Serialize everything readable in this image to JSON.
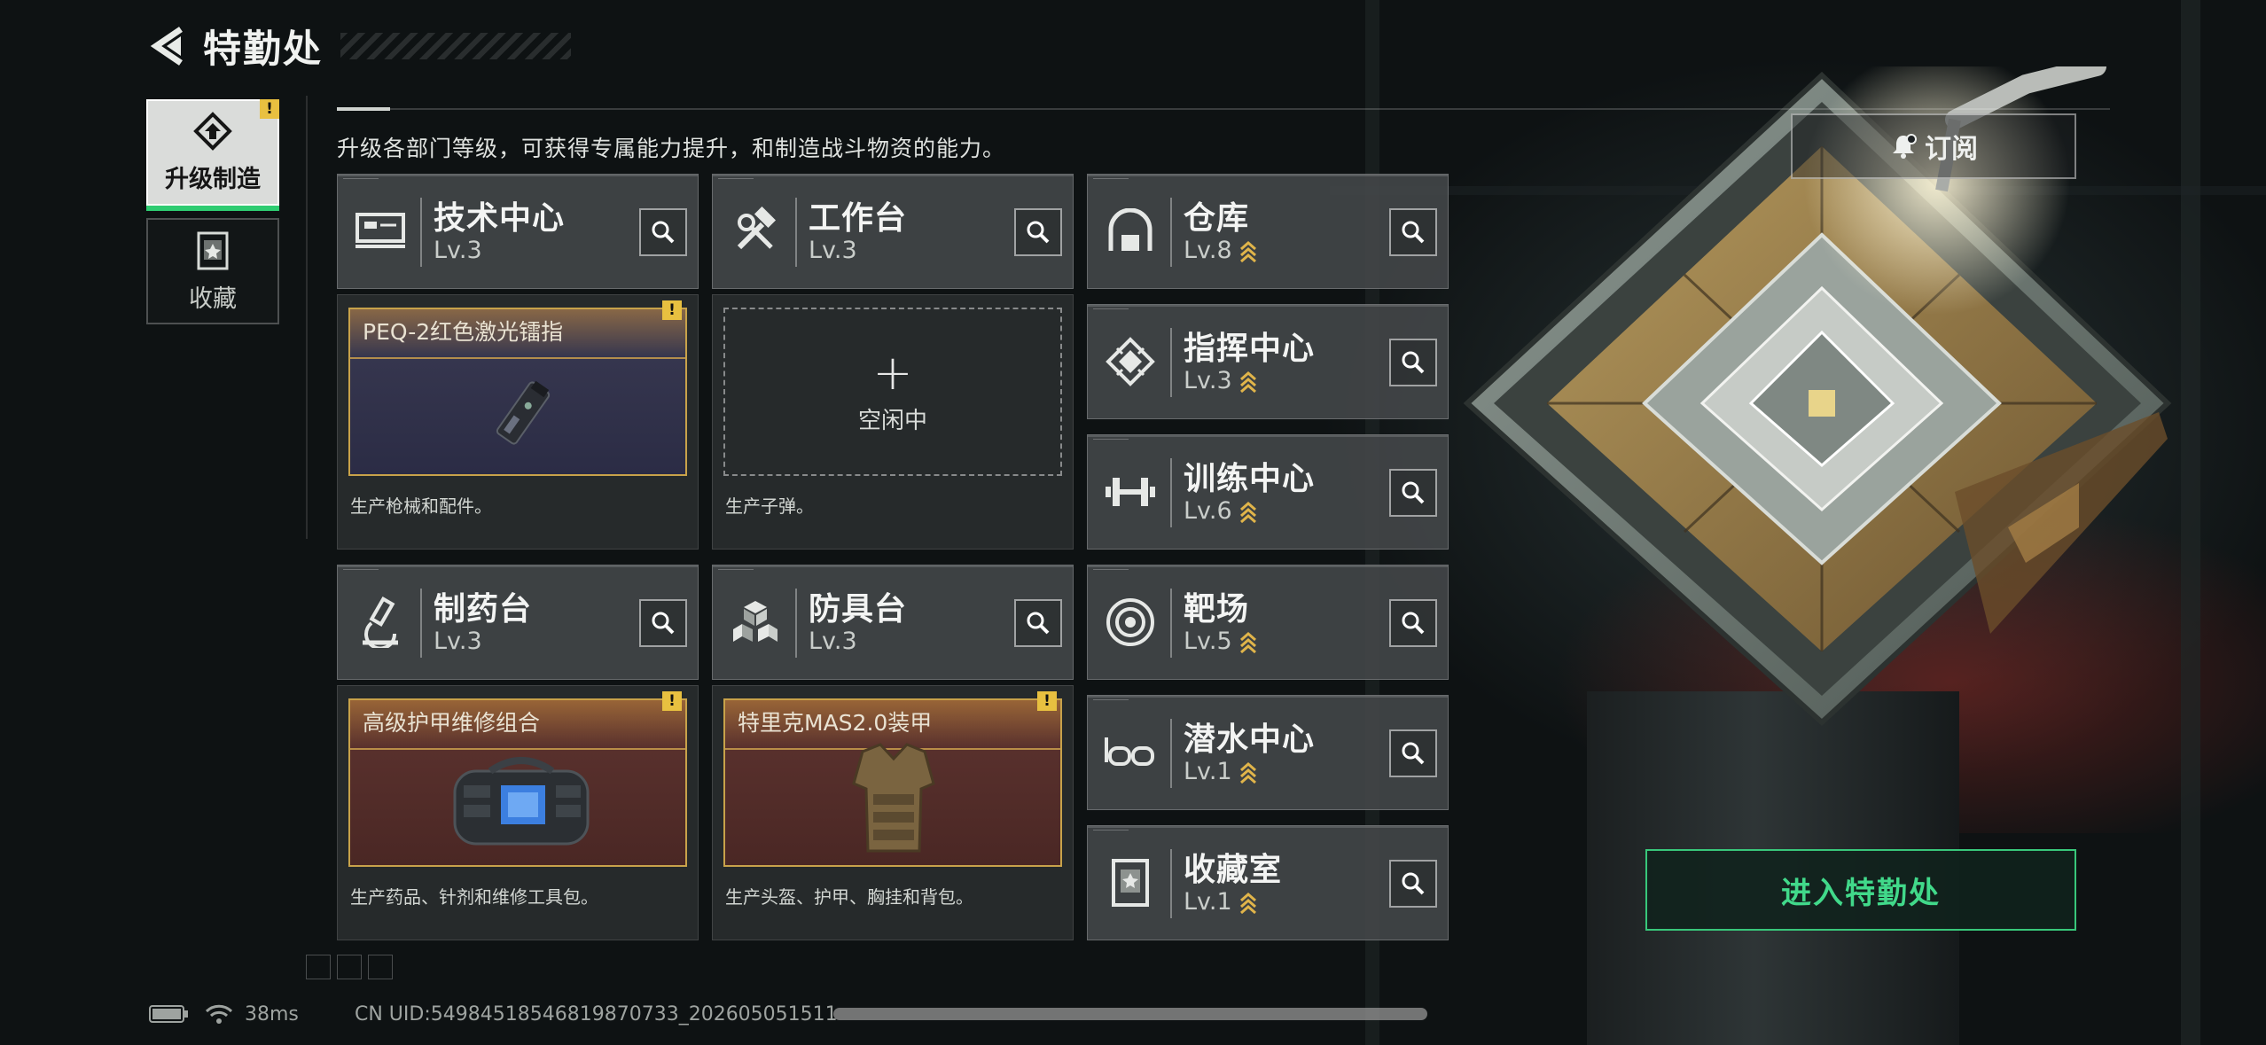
{
  "header": {
    "title": "特勤处"
  },
  "sidebar": {
    "tabs": [
      {
        "label": "升级制造",
        "active": true,
        "warning": "!"
      },
      {
        "label": "收藏",
        "active": false
      }
    ]
  },
  "intro": "升级各部门等级，可获得专属能力提升，和制造战斗物资的能力。",
  "subscribe_label": "订阅",
  "enter_label": "进入特勤处",
  "accent_color": "#41d98a",
  "warning_color": "#e8c040",
  "departments": {
    "tech": {
      "name": "技术中心",
      "level": "Lv.3",
      "icon": "tech-center-icon"
    },
    "workbench": {
      "name": "工作台",
      "level": "Lv.3",
      "icon": "hammer-wrench-icon"
    },
    "pharmacy": {
      "name": "制药台",
      "level": "Lv.3",
      "icon": "microscope-icon"
    },
    "armor": {
      "name": "防具台",
      "level": "Lv.3",
      "icon": "cubes-icon"
    },
    "warehouse": {
      "name": "仓库",
      "level": "Lv.8",
      "icon": "warehouse-icon"
    },
    "command": {
      "name": "指挥中心",
      "level": "Lv.3",
      "icon": "command-chip-icon"
    },
    "training": {
      "name": "训练中心",
      "level": "Lv.6",
      "icon": "dumbbell-icon"
    },
    "range": {
      "name": "靶场",
      "level": "Lv.5",
      "icon": "target-icon"
    },
    "diving": {
      "name": "潜水中心",
      "level": "Lv.1",
      "icon": "diving-mask-icon"
    },
    "collection": {
      "name": "收藏室",
      "level": "Lv.1",
      "icon": "trophy-case-icon"
    }
  },
  "production": {
    "tech": {
      "item": "PEQ-2红色激光镭指",
      "desc": "生产枪械和配件。",
      "warning": "!"
    },
    "workbench": {
      "idle": "空闲中",
      "desc": "生产子弹。"
    },
    "pharmacy": {
      "item": "高级护甲维修组合",
      "desc": "生产药品、针剂和维修工具包。",
      "warning": "!"
    },
    "armor": {
      "item": "特里克MAS2.0装甲",
      "desc": "生产头盔、护甲、胸挂和背包。",
      "warning": "!"
    }
  },
  "status": {
    "ping": "38ms",
    "uid": "CN UID:549845185468198707​33_20260505151​1"
  }
}
